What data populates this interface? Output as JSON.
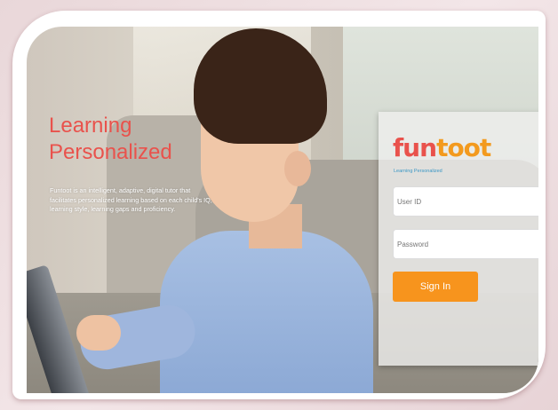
{
  "hero": {
    "headline_line1": "Learning",
    "headline_line2": "Personalized",
    "description": "Funtoot is an intelligent, adaptive, digital tutor that facilitates personalized learning based on each child's IQ, learning style, learning gaps and proficiency."
  },
  "login": {
    "logo_prefix": "fun",
    "logo_suffix": "toot",
    "tagline": "Learning Personalized",
    "user_id_placeholder": "User ID",
    "password_placeholder": "Password",
    "signin_label": "Sign In"
  },
  "colors": {
    "accent_red": "#e9524c",
    "accent_orange": "#f7941d",
    "tagline_blue": "#3a97c5"
  }
}
